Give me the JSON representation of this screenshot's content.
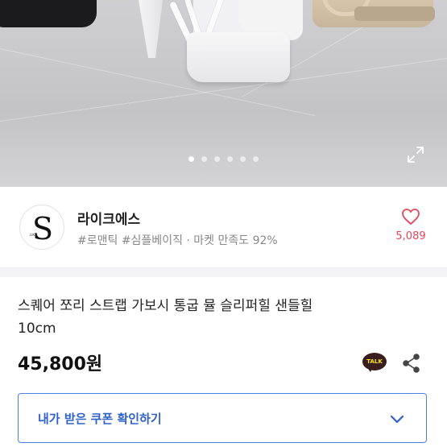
{
  "carousel": {
    "total_slides": 6,
    "active_index": 0
  },
  "shop": {
    "name": "라이크에스",
    "logo_letter": "S",
    "logo_small_text": "LIKE",
    "tags": "#로맨틱 #심플베이직 · 마켓 만족도 92%",
    "like_count": "5,089"
  },
  "product": {
    "title_line1": "스퀘어 쪼리 스트랩 가보시 통굽 뮬 슬리퍼힐 샌들힐",
    "title_line2": "10cm",
    "price": "45,800원",
    "talk_label": "TALK"
  },
  "coupon": {
    "label": "내가 받은 쿠폰 확인하기"
  },
  "colors": {
    "accent_blue": "#2f62c9",
    "like_red": "#e5455b",
    "kakao_yellow": "#fde500",
    "kakao_brown": "#3a1d1d"
  },
  "icons": {
    "expand": "expand-icon",
    "heart": "heart-icon",
    "share": "share-icon",
    "chevron": "chevron-down-icon",
    "talk": "kakao-talk-icon"
  }
}
